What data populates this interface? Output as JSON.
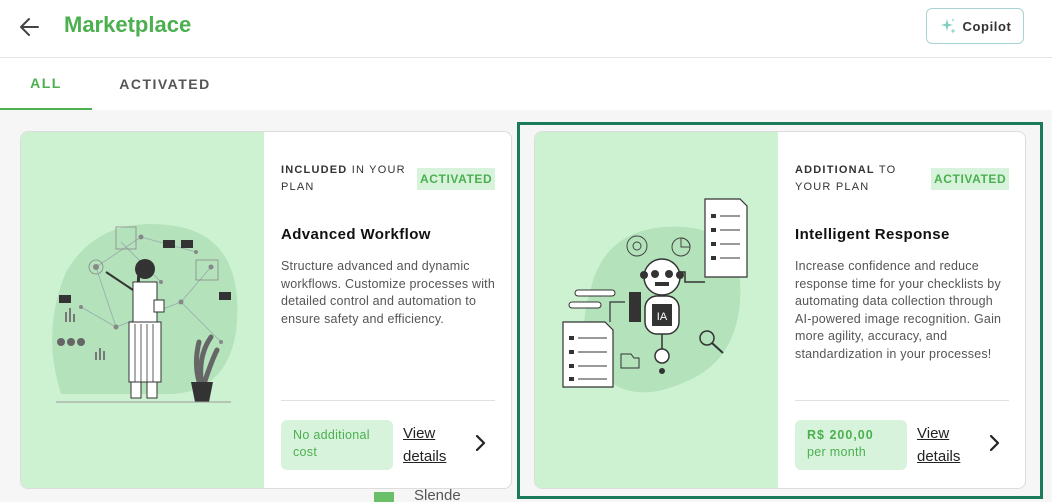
{
  "header": {
    "title": "Marketplace",
    "copilot_label": "Copilot"
  },
  "tabs": [
    {
      "label": "ALL",
      "active": true
    },
    {
      "label": "ACTIVATED",
      "active": false
    }
  ],
  "cards": [
    {
      "plan_strong": "INCLUDED",
      "plan_rest": " IN YOUR PLAN",
      "status": "ACTIVATED",
      "title": "Advanced Workflow",
      "description": "Structure advanced and dynamic workflows. Customize processes with detailed control and automation to ensure safety and efficiency.",
      "price_line1": "No additional",
      "price_line2": "cost",
      "link_label": "View details"
    },
    {
      "plan_strong": "ADDITIONAL",
      "plan_rest": " TO YOUR PLAN",
      "status": "ACTIVATED",
      "title": "Intelligent Response",
      "description": "Increase confidence and reduce response time for your checklists by automating data collection through AI-powered image recognition. Gain more agility, accuracy, and standardization in your processes!",
      "price_line1": "R$ 200,00",
      "price_line2": "per month",
      "link_label": "View details",
      "illustration_label": "IA"
    }
  ],
  "background_partial_text": "Slende",
  "colors": {
    "brand_green": "#4caf50",
    "illustration_bg": "#cdf2d2",
    "badge_bg": "#d8f3dc",
    "highlight_border": "#1b7a57"
  },
  "icons": [
    "back-arrow-icon",
    "sparkle-icon",
    "chevron-right-icon"
  ]
}
